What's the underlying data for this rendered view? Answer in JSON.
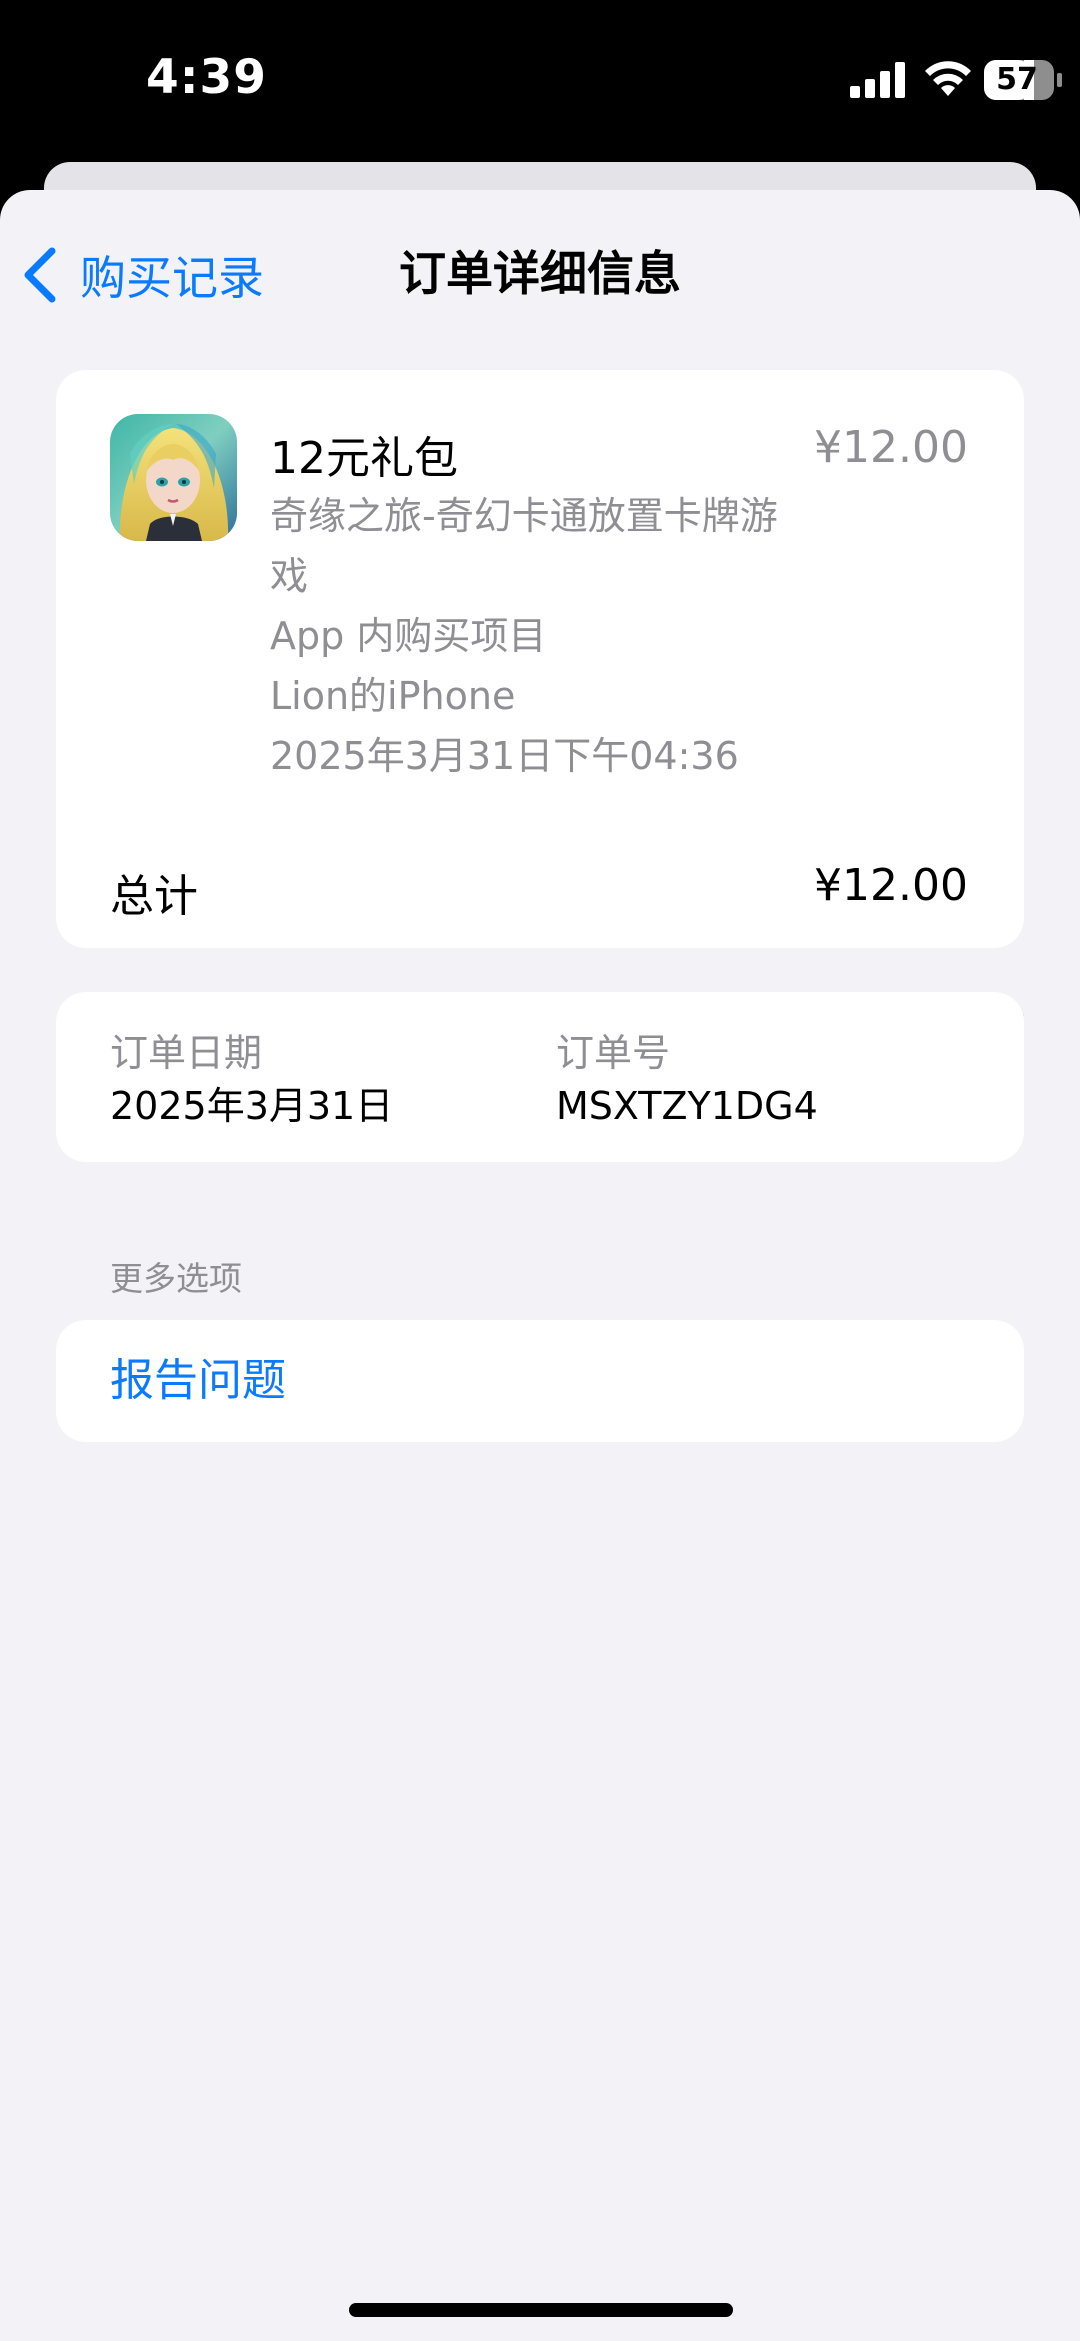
{
  "status_bar": {
    "time": "4:39",
    "battery": "57"
  },
  "nav": {
    "back_label": "购买记录",
    "title": "订单详细信息"
  },
  "item": {
    "name": "12元礼包",
    "price": "¥12.00",
    "app_name": "奇缘之旅-奇幻卡通放置卡牌游戏",
    "type": "App 内购买项目",
    "device": "Lion的iPhone",
    "datetime": "2025年3月31日下午04:36"
  },
  "total": {
    "label": "总计",
    "value": "¥12.00"
  },
  "order": {
    "date_label": "订单日期",
    "date_value": "2025年3月31日",
    "number_label": "订单号",
    "number_value": "MSXTZY1DG4"
  },
  "more_options": {
    "header": "更多选项",
    "report_label": "报告问题"
  },
  "colors": {
    "accent": "#0a7aff",
    "secondary_text": "#8e8e93",
    "background": "#f2f2f7"
  }
}
